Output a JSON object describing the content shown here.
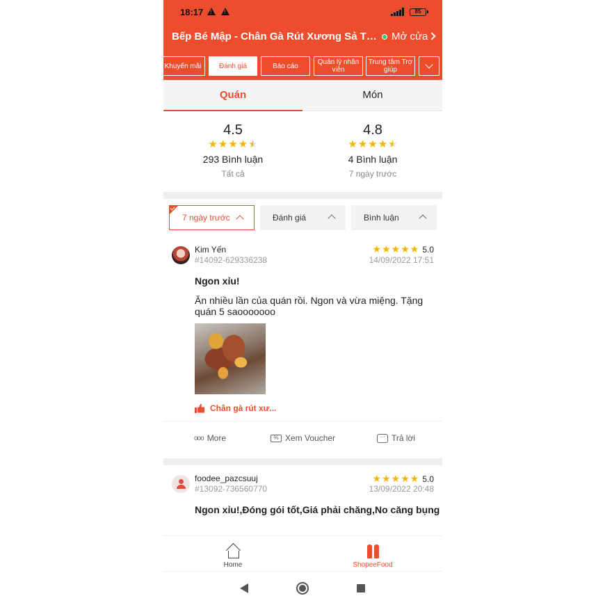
{
  "status_bar": {
    "time": "18:17",
    "network": "4G",
    "battery": "85"
  },
  "header": {
    "store_name": "Bếp Bé Mập - Chân Gà Rút Xương Sả Tắc - Tâ...",
    "open_status": "Mở cửa"
  },
  "menu_tabs": [
    {
      "label": "Khuyến mãi"
    },
    {
      "label": "Đánh giá"
    },
    {
      "label": "Báo cáo"
    },
    {
      "label": "Quản lý nhân viên"
    },
    {
      "label": "Trung tâm Trợ giúp"
    }
  ],
  "segment_tabs": [
    {
      "label": "Quán"
    },
    {
      "label": "Món"
    }
  ],
  "summary": [
    {
      "score": "4.5",
      "stars": 4.5,
      "count": "293 Bình luận",
      "period": "Tất cả"
    },
    {
      "score": "4.8",
      "stars": 4.5,
      "count": "4 Bình luận",
      "period": "7 ngày trước"
    }
  ],
  "filters": [
    {
      "label": "7 ngày trước"
    },
    {
      "label": "Đánh giá"
    },
    {
      "label": "Bình luận"
    }
  ],
  "reviews": [
    {
      "user": "Kim Yến",
      "id": "#14092-629336238",
      "rating": "5.0",
      "date": "14/09/2022 17:51",
      "title": "Ngon xỉu!",
      "body": "Ăn nhiều lần của quán rồi. Ngon và vừa miệng. Tặng quán 5 saooooooo",
      "dish": "Chân gà rút xư..."
    },
    {
      "user": "foodee_pazcsuuj",
      "id": "#13092-736560770",
      "rating": "5.0",
      "date": "13/09/2022 20:48",
      "title": "Ngon xỉu!,Đóng gói tốt,Giá phải chăng,No căng bụng"
    }
  ],
  "review_actions": {
    "more": "More",
    "voucher": "Xem Voucher",
    "reply": "Trả lời"
  },
  "bottom_nav": [
    {
      "label": "Home"
    },
    {
      "label": "ShopeeFood"
    }
  ]
}
